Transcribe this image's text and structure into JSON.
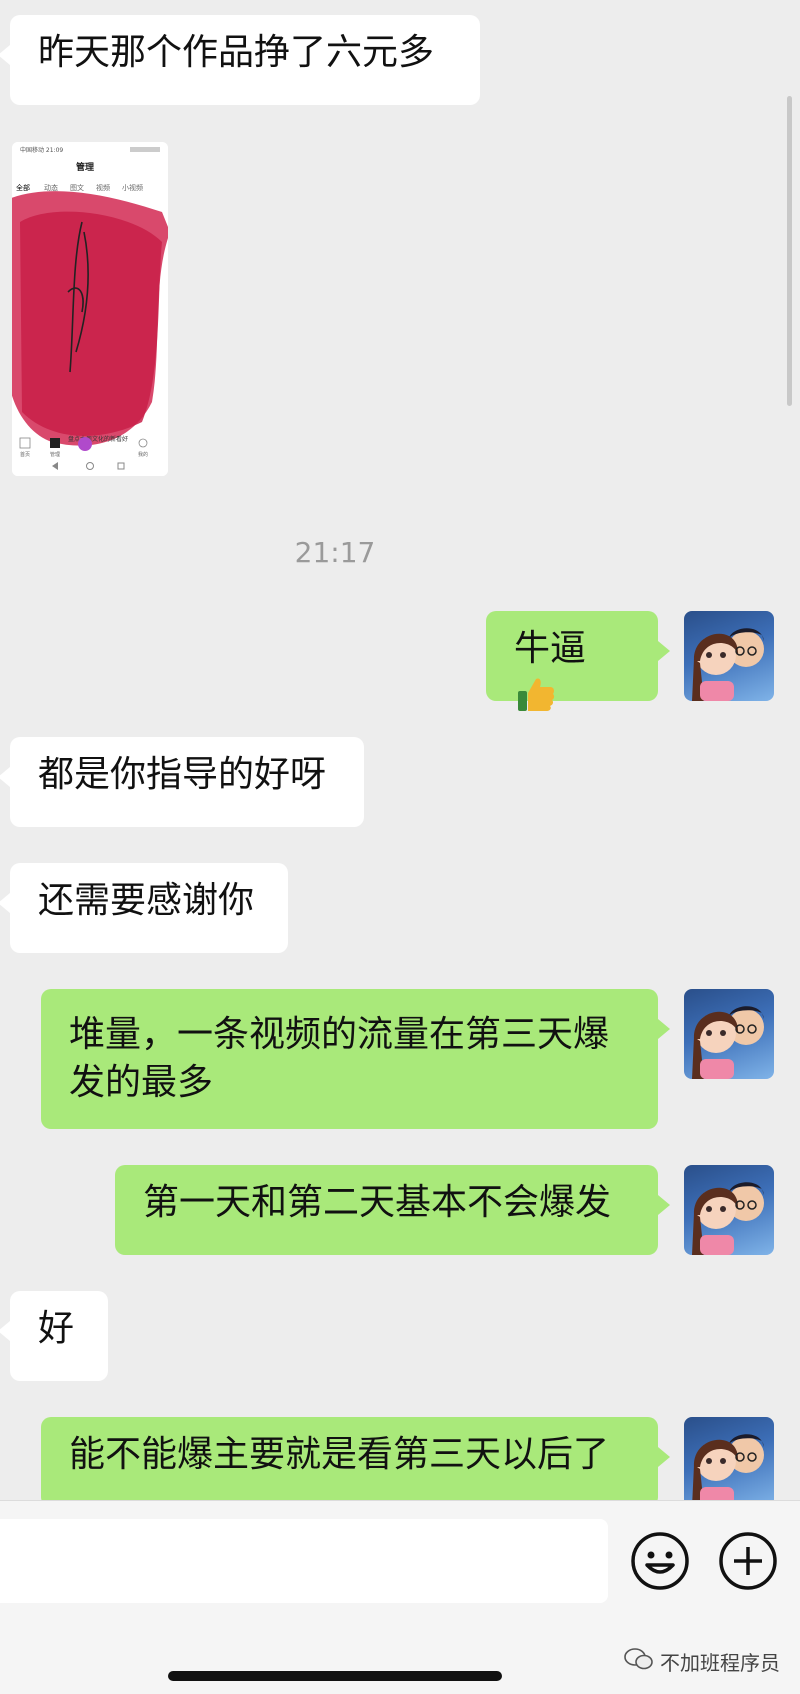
{
  "messages": {
    "m1": "昨天那个作品挣了六元多",
    "time": "21:17",
    "m2": "牛逼",
    "m3": "都是你指导的好呀",
    "m4": "还需要感谢你",
    "m5_line1": "堆量，一条视频的流量在第三天爆",
    "m5_line2": "发的最多",
    "m6": "第一天和第二天基本不会爆发",
    "m7": "好",
    "m8": "能不能爆主要就是看第三天以后了"
  },
  "thumbnail": {
    "status_time": "中国移动 21:09",
    "title": "管理",
    "tabs": [
      "全部",
      "动态",
      "图文",
      "视频",
      "小视频"
    ],
    "bottom_nav": [
      "首页",
      "管理",
      "",
      "",
      "我的"
    ],
    "footer_text": "盘点本周文化的新看好"
  },
  "watermark": "不加班程序员",
  "icons": {
    "emoji": "thumbs-up-icon",
    "emoji_button": "smiley-icon",
    "plus_button": "plus-circle-icon"
  },
  "colors": {
    "bg": "#ededed",
    "sent_bubble": "#a9e97a",
    "received_bubble": "#ffffff"
  }
}
